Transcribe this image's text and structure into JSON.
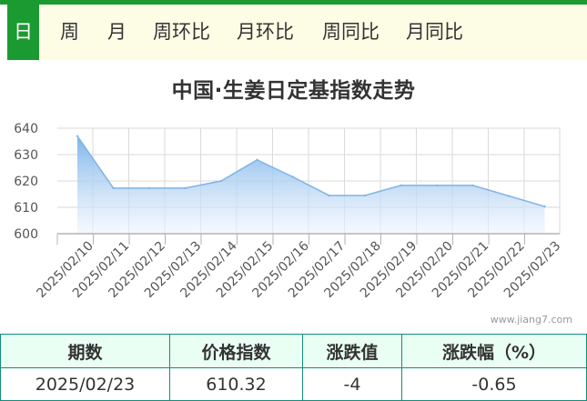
{
  "tabs": [
    {
      "label": "日",
      "active": true
    },
    {
      "label": "周",
      "active": false
    },
    {
      "label": "月",
      "active": false
    },
    {
      "label": "周环比",
      "active": false
    },
    {
      "label": "月环比",
      "active": false
    },
    {
      "label": "周同比",
      "active": false
    },
    {
      "label": "月同比",
      "active": false
    }
  ],
  "chart_data": {
    "type": "area",
    "title": "中国·生姜日定基指数走势",
    "x": [
      "2025/02/10",
      "2025/02/11",
      "2025/02/12",
      "2025/02/13",
      "2025/02/14",
      "2025/02/15",
      "2025/02/16",
      "2025/02/17",
      "2025/02/18",
      "2025/02/19",
      "2025/02/20",
      "2025/02/21",
      "2025/02/22",
      "2025/02/23"
    ],
    "values": [
      637,
      617.3,
      617.3,
      617.3,
      620,
      628,
      621.5,
      614.5,
      614.5,
      618.3,
      618.3,
      618.3,
      614.3,
      610.32
    ],
    "yticks": [
      600,
      610,
      620,
      630,
      640
    ],
    "ylim": [
      600,
      640
    ],
    "grid": true,
    "colors": {
      "line": "#7fb4e8",
      "fill_top": "#78b1e9",
      "fill_bottom": "#eef5fd",
      "grid": "#dadada",
      "axis": "#b3b3b3"
    }
  },
  "watermark": "www.jiang7.com",
  "summary": {
    "headers": [
      "期数",
      "价格指数",
      "涨跌值",
      "涨跌幅（%）"
    ],
    "row": [
      "2025/02/23",
      "610.32",
      "-4",
      "-0.65"
    ]
  },
  "colors": {
    "brand_green": "#1c9a32",
    "table_border": "#148c7c"
  }
}
